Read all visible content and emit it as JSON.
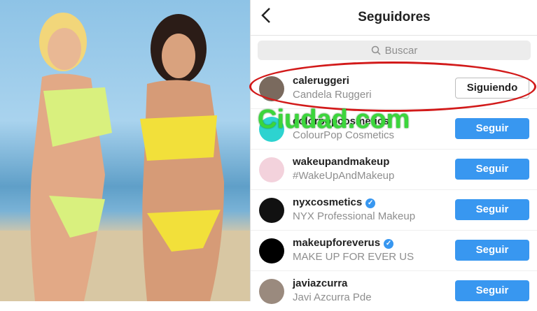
{
  "header": {
    "title": "Seguidores",
    "back_icon": "chevron-left-icon"
  },
  "search": {
    "placeholder": "Buscar",
    "icon": "search-icon"
  },
  "accounts": [
    {
      "username": "caleruggeri",
      "fullname": "Candela Ruggeri",
      "verified": false,
      "button": "Siguiendo"
    },
    {
      "username": "colorpopcosmetics",
      "fullname": "ColourPop Cosmetics",
      "verified": false,
      "button": "Seguir"
    },
    {
      "username": "wakeupandmakeup",
      "fullname": "#WakeUpAndMakeup",
      "verified": false,
      "button": "Seguir"
    },
    {
      "username": "nyxcosmetics",
      "fullname": "NYX Professional Makeup",
      "verified": true,
      "button": "Seguir"
    },
    {
      "username": "makeupforeverus",
      "fullname": "MAKE UP FOR EVER US",
      "verified": true,
      "button": "Seguir"
    },
    {
      "username": "javiazcurra",
      "fullname": "Javi Azcurra Pde",
      "verified": false,
      "button": "Seguir"
    }
  ],
  "watermark": "Ciudad.com",
  "colors": {
    "follow_blue": "#3897f0",
    "highlight_red": "#d21a1a",
    "watermark_green": "#3bd63b"
  }
}
